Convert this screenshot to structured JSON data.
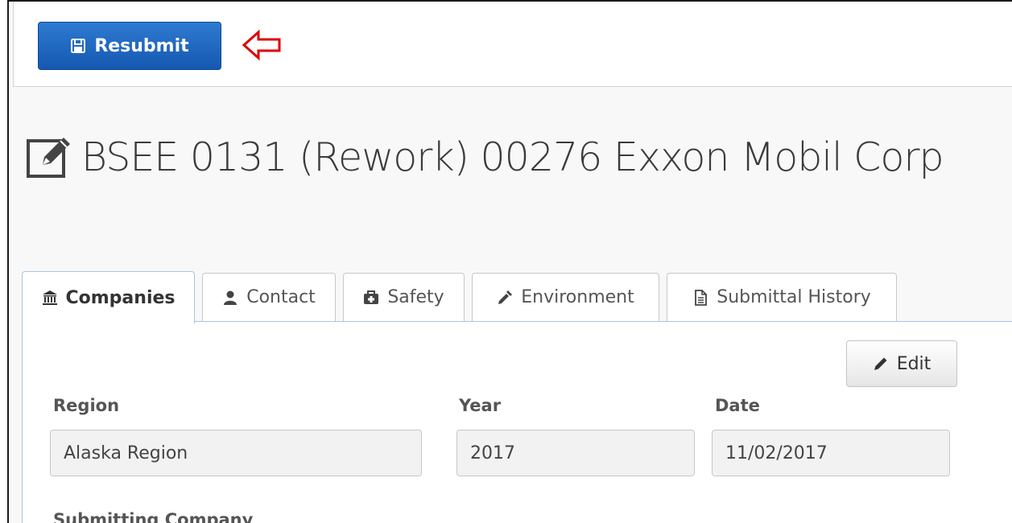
{
  "toolbar": {
    "resubmit_label": "Resubmit"
  },
  "page": {
    "title": "BSEE 0131 (Rework) 00276 Exxon Mobil Corp"
  },
  "tabs": [
    {
      "label": "Companies",
      "icon": "bank-icon",
      "active": true
    },
    {
      "label": "Contact",
      "icon": "user-icon",
      "active": false
    },
    {
      "label": "Safety",
      "icon": "medkit-icon",
      "active": false
    },
    {
      "label": "Environment",
      "icon": "eyedropper-icon",
      "active": false
    },
    {
      "label": "Submittal History",
      "icon": "document-icon",
      "active": false
    }
  ],
  "form": {
    "edit_label": "Edit",
    "region": {
      "label": "Region",
      "value": "Alaska Region"
    },
    "year": {
      "label": "Year",
      "value": "2017"
    },
    "date": {
      "label": "Date",
      "value": "11/02/2017"
    },
    "submitting_company": {
      "label": "Submitting Company"
    }
  },
  "colors": {
    "primary": "#1a64c0",
    "annotation": "#e00000",
    "tab_border_active": "#a9c4e4"
  }
}
